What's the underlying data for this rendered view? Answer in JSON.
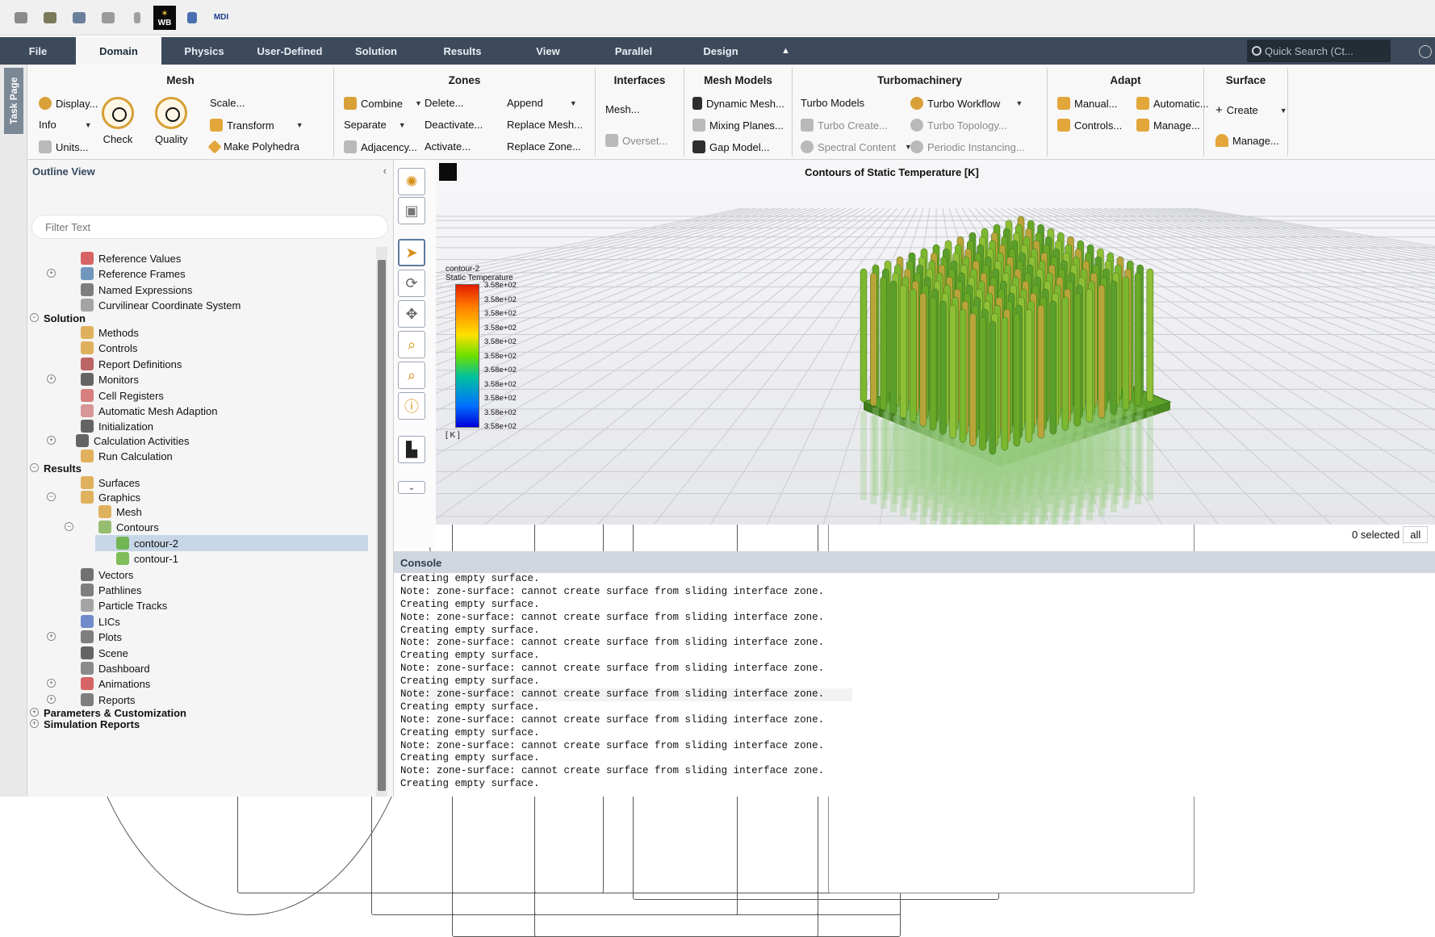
{
  "quick_access": {
    "workbench_label": "WB",
    "mdi_label": "MDI"
  },
  "tabs": [
    "File",
    "Domain",
    "Physics",
    "User-Defined",
    "Solution",
    "Results",
    "View",
    "Parallel",
    "Design"
  ],
  "active_tab": "Domain",
  "quick_search": {
    "placeholder": "Quick Search (Ct..."
  },
  "task_page_label": "Task Page",
  "ribbon": {
    "mesh": {
      "title": "Mesh",
      "display": "Display...",
      "info": "Info",
      "units": "Units...",
      "check": "Check",
      "quality": "Quality",
      "scale": "Scale...",
      "transform": "Transform",
      "make_polyhedra": "Make Polyhedra"
    },
    "zones": {
      "title": "Zones",
      "combine": "Combine",
      "separate": "Separate",
      "adjacency": "Adjacency...",
      "delete": "Delete...",
      "deactivate": "Deactivate...",
      "activate": "Activate...",
      "append": "Append",
      "replace_mesh": "Replace Mesh...",
      "replace_zone": "Replace Zone..."
    },
    "interfaces": {
      "title": "Interfaces",
      "mesh": "Mesh...",
      "overset": "Overset..."
    },
    "mesh_models": {
      "title": "Mesh Models",
      "dynamic_mesh": "Dynamic Mesh...",
      "mixing_planes": "Mixing Planes...",
      "gap_model": "Gap Model..."
    },
    "turbomachinery": {
      "title": "Turbomachinery",
      "turbo_models": "Turbo Models",
      "turbo_create": "Turbo Create...",
      "spectral_content": "Spectral Content",
      "turbo_workflow": "Turbo Workflow",
      "turbo_topology": "Turbo Topology...",
      "periodic_instancing": "Periodic Instancing..."
    },
    "adapt": {
      "title": "Adapt",
      "manual": "Manual...",
      "controls": "Controls...",
      "automatic": "Automatic...",
      "manage": "Manage..."
    },
    "surface": {
      "title": "Surface",
      "create": "Create",
      "manage": "Manage..."
    }
  },
  "outline": {
    "title": "Outline View",
    "filter_placeholder": "Filter Text",
    "nodes": [
      "Reference Values",
      "Reference Frames",
      "Named Expressions",
      "Curvilinear Coordinate System",
      "Solution",
      "Methods",
      "Controls",
      "Report Definitions",
      "Monitors",
      "Cell Registers",
      "Automatic Mesh Adaption",
      "Initialization",
      "Calculation Activities",
      "Run Calculation",
      "Results",
      "Surfaces",
      "Graphics",
      "Mesh",
      "Contours",
      "contour-2",
      "contour-1",
      "Vectors",
      "Pathlines",
      "Particle Tracks",
      "LICs",
      "Plots",
      "Scene",
      "Dashboard",
      "Animations",
      "Reports",
      "Parameters & Customization",
      "Simulation Reports"
    ]
  },
  "graphics": {
    "title": "Contours of Static Temperature [K]",
    "legend": {
      "name": "contour-2",
      "variable": "Static Temperature",
      "unit": "[ K ]",
      "ticks": [
        "3.58e+02",
        "3.58e+02",
        "3.58e+02",
        "3.58e+02",
        "3.58e+02",
        "3.58e+02",
        "3.58e+02",
        "3.58e+02",
        "3.58e+02",
        "3.58e+02",
        "3.58e+02"
      ]
    }
  },
  "selection": {
    "count_text": "0 selected",
    "filter": "all"
  },
  "console": {
    "title": "Console",
    "lines": [
      "Creating empty surface.",
      "Note: zone-surface: cannot create surface from sliding interface zone.",
      "Creating empty surface.",
      "Note: zone-surface: cannot create surface from sliding interface zone.",
      "Creating empty surface.",
      "Note: zone-surface: cannot create surface from sliding interface zone.",
      "Creating empty surface.",
      "Note: zone-surface: cannot create surface from sliding interface zone.",
      "Creating empty surface.",
      "Note: zone-surface: cannot create surface from sliding interface zone.",
      "Creating empty surface.",
      "Note: zone-surface: cannot create surface from sliding interface zone.",
      "Creating empty surface.",
      "Note: zone-surface: cannot create surface from sliding interface zone.",
      "Creating empty surface.",
      "Note: zone-surface: cannot create surface from sliding interface zone.",
      "Creating empty surface."
    ]
  },
  "colors": {
    "tab_bar": "#3d4a5c",
    "accent": "#d9a03a",
    "selection": "#c8d7e8"
  }
}
